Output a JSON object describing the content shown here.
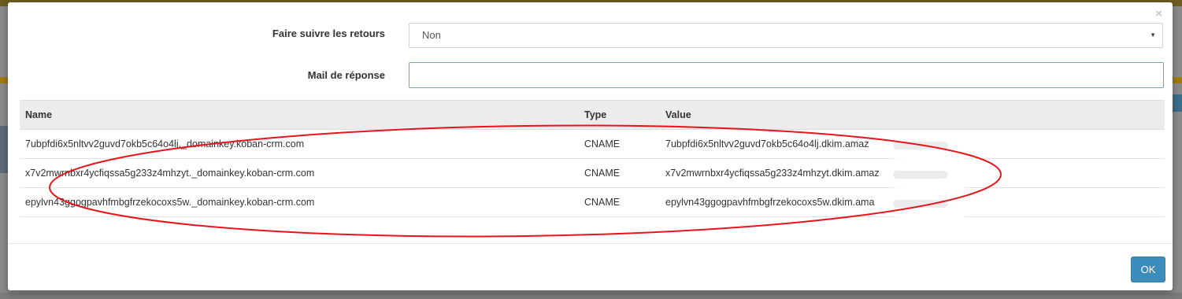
{
  "modal": {
    "close_glyph": "×",
    "form": {
      "follow_returns": {
        "label": "Faire suivre les retours",
        "value": "Non"
      },
      "reply_mail": {
        "label": "Mail de réponse",
        "value": ""
      }
    },
    "dns_table": {
      "headers": [
        "Name",
        "Type",
        "Value"
      ],
      "rows": [
        [
          "7ubpfdi6x5nltvv2guvd7okb5c64o4lj._domainkey.koban-crm.com",
          "CNAME",
          "7ubpfdi6x5nltvv2guvd7okb5c64o4lj.dkim.amaz"
        ],
        [
          "x7v2mwrnbxr4ycfiqssa5g233z4mhzyt._domainkey.koban-crm.com",
          "CNAME",
          "x7v2mwrnbxr4ycfiqssa5g233z4mhzyt.dkim.amaz"
        ],
        [
          "epylvn43ggogpavhfmbgfrzekocoxs5w._domainkey.koban-crm.com",
          "CNAME",
          "epylvn43ggogpavhfmbgfrzekocoxs5w.dkim.ama"
        ]
      ]
    },
    "ok_label": "OK"
  },
  "colors": {
    "primary_button": "#3c8dbc",
    "annotation": "#e8141b",
    "input_focus_border": "#66a3d9"
  }
}
